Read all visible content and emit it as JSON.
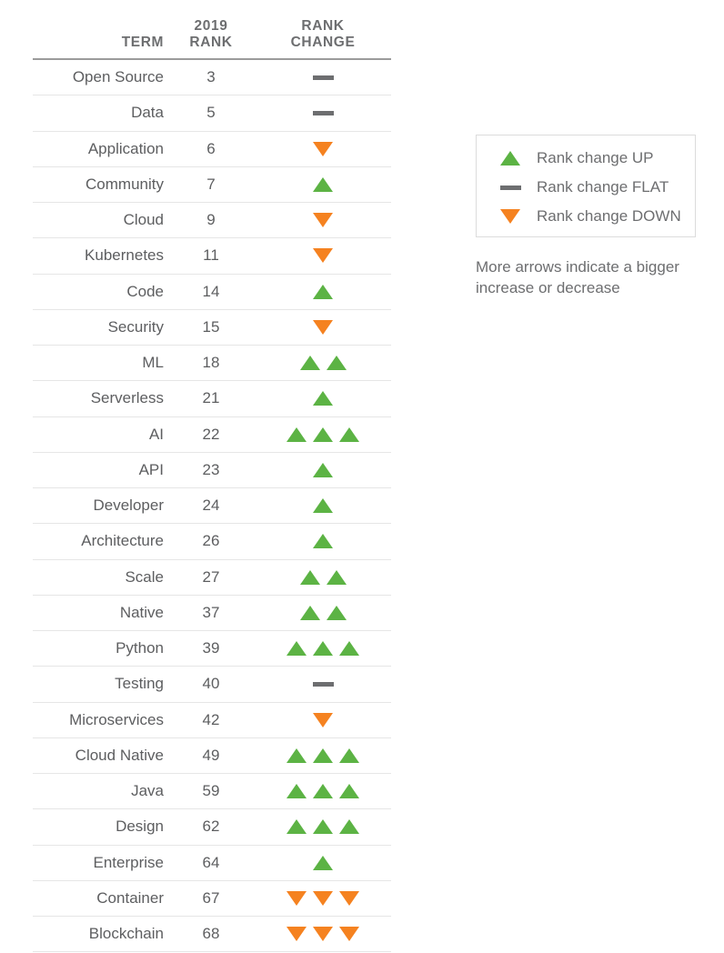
{
  "table": {
    "headers": {
      "term": "TERM",
      "rank_line1": "2019",
      "rank_line2": "RANK",
      "change_line1": "RANK",
      "change_line2": "CHANGE"
    },
    "rows": [
      {
        "term": "Open Source",
        "rank": "3",
        "change": "flat",
        "count": 1
      },
      {
        "term": "Data",
        "rank": "5",
        "change": "flat",
        "count": 1
      },
      {
        "term": "Application",
        "rank": "6",
        "change": "down",
        "count": 1
      },
      {
        "term": "Community",
        "rank": "7",
        "change": "up",
        "count": 1
      },
      {
        "term": "Cloud",
        "rank": "9",
        "change": "down",
        "count": 1
      },
      {
        "term": "Kubernetes",
        "rank": "11",
        "change": "down",
        "count": 1
      },
      {
        "term": "Code",
        "rank": "14",
        "change": "up",
        "count": 1
      },
      {
        "term": "Security",
        "rank": "15",
        "change": "down",
        "count": 1
      },
      {
        "term": "ML",
        "rank": "18",
        "change": "up",
        "count": 2
      },
      {
        "term": "Serverless",
        "rank": "21",
        "change": "up",
        "count": 1
      },
      {
        "term": "AI",
        "rank": "22",
        "change": "up",
        "count": 3
      },
      {
        "term": "API",
        "rank": "23",
        "change": "up",
        "count": 1
      },
      {
        "term": "Developer",
        "rank": "24",
        "change": "up",
        "count": 1
      },
      {
        "term": "Architecture",
        "rank": "26",
        "change": "up",
        "count": 1
      },
      {
        "term": "Scale",
        "rank": "27",
        "change": "up",
        "count": 2
      },
      {
        "term": "Native",
        "rank": "37",
        "change": "up",
        "count": 2
      },
      {
        "term": "Python",
        "rank": "39",
        "change": "up",
        "count": 3
      },
      {
        "term": "Testing",
        "rank": "40",
        "change": "flat",
        "count": 1
      },
      {
        "term": "Microservices",
        "rank": "42",
        "change": "down",
        "count": 1
      },
      {
        "term": "Cloud Native",
        "rank": "49",
        "change": "up",
        "count": 3
      },
      {
        "term": "Java",
        "rank": "59",
        "change": "up",
        "count": 3
      },
      {
        "term": "Design",
        "rank": "62",
        "change": "up",
        "count": 3
      },
      {
        "term": "Enterprise",
        "rank": "64",
        "change": "up",
        "count": 1
      },
      {
        "term": "Container",
        "rank": "67",
        "change": "down",
        "count": 3
      },
      {
        "term": "Blockchain",
        "rank": "68",
        "change": "down",
        "count": 3
      }
    ]
  },
  "legend": {
    "items": [
      {
        "glyph": "up",
        "label": "Rank change UP"
      },
      {
        "glyph": "flat",
        "label": "Rank change FLAT"
      },
      {
        "glyph": "down",
        "label": "Rank change DOWN"
      }
    ],
    "note": "More arrows indicate a bigger increase or decrease"
  },
  "colors": {
    "up": "#5cb344",
    "down": "#f58220",
    "flat": "#6d6e70",
    "text": "#5d5e60",
    "header_text": "#6d6e70",
    "rule": "#e6e6e6",
    "header_rule": "#9b9b9b",
    "legend_border": "#dcdcdc"
  }
}
